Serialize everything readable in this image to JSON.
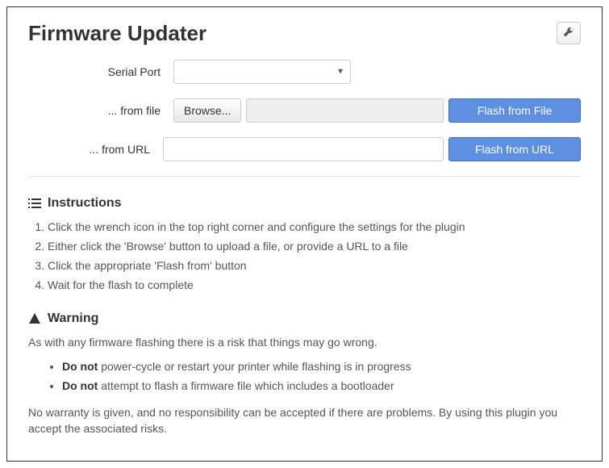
{
  "header": {
    "title": "Firmware Updater"
  },
  "form": {
    "serial_port": {
      "label": "Serial Port",
      "value": ""
    },
    "from_file": {
      "label": "... from file",
      "browse_label": "Browse...",
      "file_value": "",
      "flash_label": "Flash from File"
    },
    "from_url": {
      "label": "... from URL",
      "url_value": "",
      "flash_label": "Flash from URL"
    }
  },
  "instructions": {
    "heading": "Instructions",
    "items": [
      "Click the wrench icon in the top right corner and configure the settings for the plugin",
      "Either click the 'Browse' button to upload a file, or provide a URL to a file",
      "Click the appropriate 'Flash from' button",
      "Wait for the flash to complete"
    ]
  },
  "warning": {
    "heading": "Warning",
    "intro": "As with any firmware flashing there is a risk that things may go wrong.",
    "bullets": [
      {
        "bold": "Do not",
        "rest": " power-cycle or restart your printer while flashing is in progress"
      },
      {
        "bold": "Do not",
        "rest": " attempt to flash a firmware file which includes a bootloader"
      }
    ],
    "disclaimer": "No warranty is given, and no responsibility can be accepted if there are problems. By using this plugin you accept the associated risks."
  }
}
